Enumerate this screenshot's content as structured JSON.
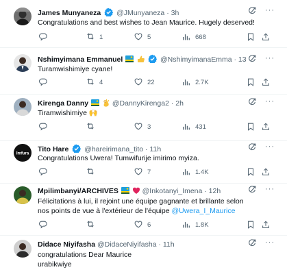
{
  "tweets": [
    {
      "name": "James Munyaneza",
      "handle": "@JMunyaneza",
      "time": "· 3h",
      "text": "Congratulations and best wishes to Jean Maurice. Hugely deserved!",
      "reply": "",
      "retweet": "1",
      "like": "5",
      "views": "668"
    },
    {
      "name": "Nshimyimana Emmanuel",
      "handle": "@NshimyimanaEmma",
      "time": "· 13h",
      "text": "Turamwishimiye cyane!",
      "reply": "",
      "retweet": "4",
      "like": "22",
      "views": "2.7K"
    },
    {
      "name": "Kirenga Danny",
      "handle": "@DannyKirenga2",
      "time": "· 2h",
      "text": "Tiramwishimiye 🙌",
      "reply": "",
      "retweet": "",
      "like": "3",
      "views": "431"
    },
    {
      "name": "Tito Hare",
      "handle": "@hareirimana_tito",
      "time": "· 11h",
      "text": "Congratulations Uwera! Tumwifurije imirimo myiza.",
      "reply": "",
      "retweet": "",
      "like": "7",
      "views": "1.4K"
    },
    {
      "name": "Mpilimbanyi/ARCHIVES",
      "handle": "@Inkotanyi_Imena",
      "time": "· 12h",
      "text": "Félicitations à lui, il rejoint une équipe gagnante et brillante selon nos points de vue à l'extérieur de l'équipe",
      "mention": "@Uwera_I_Maurice",
      "reply": "",
      "retweet": "",
      "like": "6",
      "views": "1.8K"
    },
    {
      "name": "Didace Niyifasha",
      "handle": "@DidaceNiyifasha",
      "time": "· 11h",
      "text": "congratulations Dear Maurice",
      "text2": "urabikwiye"
    }
  ],
  "avatar_tito_text": "Imfura",
  "colors": {
    "accent": "#1d9bf0",
    "muted": "#536471",
    "text": "#0f1419",
    "divider": "#eff3f4"
  }
}
